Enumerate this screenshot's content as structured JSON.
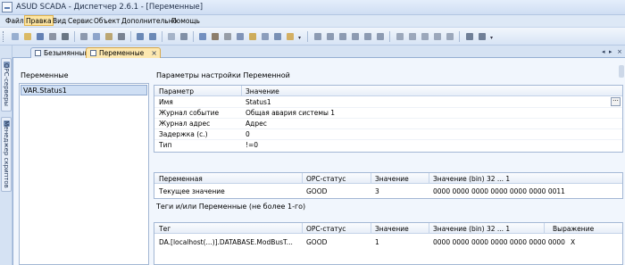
{
  "window": {
    "title": "ASUD SCADA - Диспетчер 2.6.1 - [Переменные]"
  },
  "menu": {
    "items": [
      "Файл",
      "Правка",
      "Вид",
      "Сервис",
      "Объект",
      "Дополнительно",
      "Помощь"
    ],
    "active": "Правка"
  },
  "sidebar_tabs": [
    "OPC-серверы",
    "Менеджер скриптов"
  ],
  "doc_tabs": [
    {
      "label": "Безымянный",
      "active": false
    },
    {
      "label": "Переменные",
      "active": true
    }
  ],
  "variables": {
    "title": "Переменные",
    "items": [
      "VAR.Status1"
    ]
  },
  "settings": {
    "title": "Параметры настройки Переменной",
    "columns": [
      "Параметр",
      "Значение"
    ],
    "rows": [
      {
        "param": "Имя",
        "value": "Status1"
      },
      {
        "param": "Журнал событие",
        "value": "Общая авария системы 1"
      },
      {
        "param": "Журнал адрес",
        "value": "Адрес"
      },
      {
        "param": "Задержка (с.)",
        "value": "0"
      },
      {
        "param": "Тип",
        "value": "!=0"
      }
    ]
  },
  "status_grid": {
    "columns": [
      "Переменная",
      "OPC-статус",
      "Значение",
      "Значение (bin)  32 ... 1"
    ],
    "rows": [
      [
        "Текущее значение",
        "GOOD",
        "3",
        "0000 0000 0000 0000 0000 0000 0011"
      ]
    ]
  },
  "tags": {
    "title": "Теги и/или Переменные     (не более 1-го)",
    "columns": [
      "Тег",
      "OPC-статус",
      "Значение",
      "Значение (bin)  32 ... 1",
      "Выражение"
    ],
    "rows": [
      [
        "DA.[localhost(...)].DATABASE.ModBusT...",
        "GOOD",
        "1",
        "0000 0000 0000 0000 0000 0000 0000",
        "X"
      ]
    ]
  },
  "icons": {
    "toolbar": [
      "new-icon",
      "open-icon",
      "save-icon",
      "print-icon",
      "cut-icon",
      "copy-icon",
      "paste-icon",
      "delete-icon",
      "undo-icon",
      "redo-icon",
      "properties-icon",
      "find-icon",
      "comment-icon",
      "tools-icon",
      "settings-icon",
      "link-icon",
      "diamond-icon",
      "import-icon",
      "export-icon",
      "align-left-icon",
      "align-center-icon",
      "align-right-icon",
      "align-top-icon",
      "align-middle-icon",
      "align-bottom-icon",
      "same-width-icon",
      "same-height-icon",
      "same-size-icon",
      "grid-icon",
      "snap-icon"
    ]
  },
  "colors": {
    "active_tab": "#fde8b0",
    "selection": "#cfdff4",
    "accent": "#d9a849"
  }
}
